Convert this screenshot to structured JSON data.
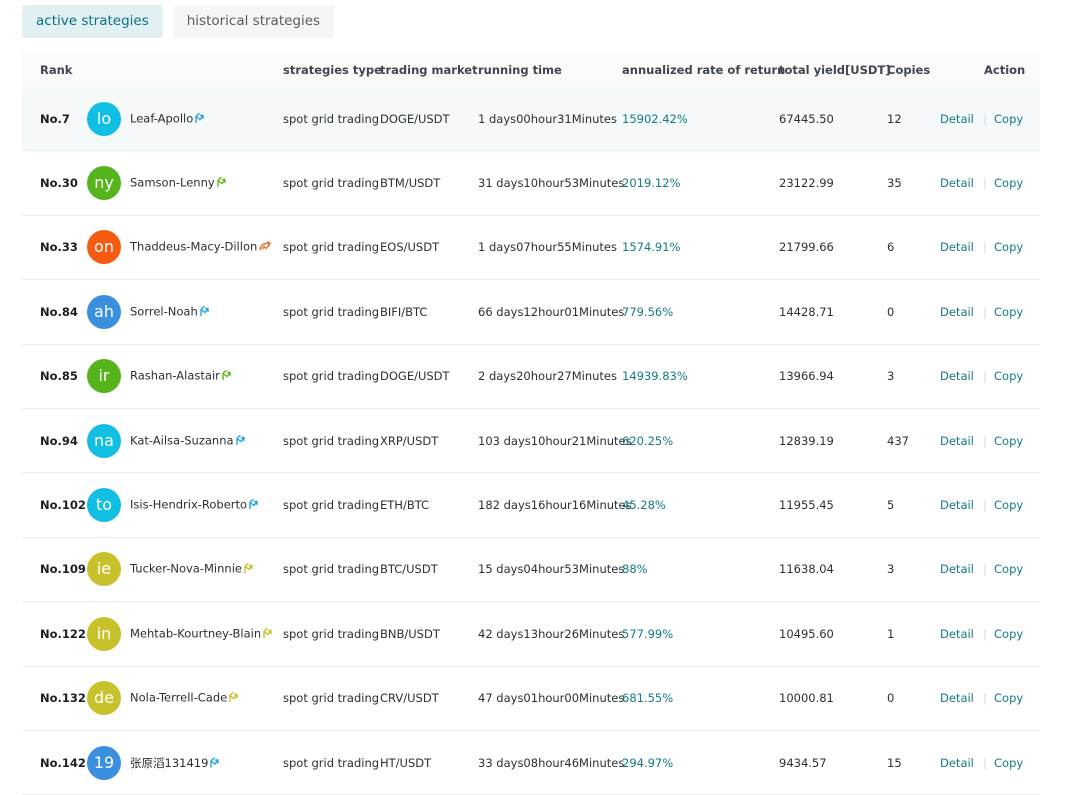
{
  "tabs": [
    {
      "label": "active strategies",
      "active": true
    },
    {
      "label": "historical strategies",
      "active": false
    }
  ],
  "table": {
    "headers": {
      "rank": "Rank",
      "type": "strategies type",
      "market": "trading market",
      "time": "running time",
      "rate": "annualized rate of return",
      "yield": "total yield[USDT]",
      "copies": "Copies",
      "action": "Action"
    },
    "detail_label": "Detail",
    "copy_label": "Copy",
    "separator": "|",
    "colors": {
      "accent": "#127a84",
      "badge_blue": "#22a6e0",
      "badge_green": "#5fb81e",
      "badge_olive": "#c4c025",
      "badge_orange": "#f26522"
    },
    "rows": [
      {
        "rank": "No.7",
        "initials": "lo",
        "avatar_color": "#11bfe3",
        "name": "Leaf-Apollo",
        "badge_color": "#22a6e0",
        "badge_icon": "growth-badge-icon",
        "type": "spot grid trading",
        "market": "DOGE/USDT",
        "time": "1 days00hour31Minutes",
        "rate": "15902.42%",
        "yield": "67445.50",
        "copies": "12"
      },
      {
        "rank": "No.30",
        "initials": "ny",
        "avatar_color": "#55b41c",
        "name": "Samson-Lenny",
        "badge_color": "#5fb81e",
        "badge_icon": "growth-badge-icon",
        "type": "spot grid trading",
        "market": "BTM/USDT",
        "time": "31 days10hour53Minutes",
        "rate": "2019.12%",
        "yield": "23122.99",
        "copies": "35"
      },
      {
        "rank": "No.33",
        "initials": "on",
        "avatar_color": "#f75b12",
        "name": "Thaddeus-Macy-Dillon",
        "badge_color": "#f26522",
        "badge_icon": "flame-badge-icon",
        "type": "spot grid trading",
        "market": "EOS/USDT",
        "time": "1 days07hour55Minutes",
        "rate": "1574.91%",
        "yield": "21799.66",
        "copies": "6"
      },
      {
        "rank": "No.84",
        "initials": "ah",
        "avatar_color": "#3b8fdf",
        "name": "Sorrel-Noah",
        "badge_color": "#22a6e0",
        "badge_icon": "growth-badge-icon",
        "type": "spot grid trading",
        "market": "BIFI/BTC",
        "time": "66 days12hour01Minutes",
        "rate": "779.56%",
        "yield": "14428.71",
        "copies": "0"
      },
      {
        "rank": "No.85",
        "initials": "ir",
        "avatar_color": "#55b41c",
        "name": "Rashan-Alastair",
        "badge_color": "#5fb81e",
        "badge_icon": "growth-badge-icon",
        "type": "spot grid trading",
        "market": "DOGE/USDT",
        "time": "2 days20hour27Minutes",
        "rate": "14939.83%",
        "yield": "13966.94",
        "copies": "3"
      },
      {
        "rank": "No.94",
        "initials": "na",
        "avatar_color": "#11bfe3",
        "name": "Kat-Ailsa-Suzanna",
        "badge_color": "#22a6e0",
        "badge_icon": "growth-badge-icon",
        "type": "spot grid trading",
        "market": "XRP/USDT",
        "time": "103 days10hour21Minutes",
        "rate": "620.25%",
        "yield": "12839.19",
        "copies": "437"
      },
      {
        "rank": "No.102",
        "initials": "to",
        "avatar_color": "#11bfe3",
        "name": "Isis-Hendrix-Roberto",
        "badge_color": "#22a6e0",
        "badge_icon": "growth-badge-icon",
        "type": "spot grid trading",
        "market": "ETH/BTC",
        "time": "182 days16hour16Minutes",
        "rate": "45.28%",
        "yield": "11955.45",
        "copies": "5"
      },
      {
        "rank": "No.109",
        "initials": "ie",
        "avatar_color": "#c7c12b",
        "name": "Tucker-Nova-Minnie",
        "badge_color": "#c4c025",
        "badge_icon": "growth-badge-icon",
        "type": "spot grid trading",
        "market": "BTC/USDT",
        "time": "15 days04hour53Minutes",
        "rate": "88%",
        "yield": "11638.04",
        "copies": "3"
      },
      {
        "rank": "No.122",
        "initials": "in",
        "avatar_color": "#c7c12b",
        "name": "Mehtab-Kourtney-Blain",
        "badge_color": "#c4c025",
        "badge_icon": "growth-badge-icon",
        "type": "spot grid trading",
        "market": "BNB/USDT",
        "time": "42 days13hour26Minutes",
        "rate": "577.99%",
        "yield": "10495.60",
        "copies": "1"
      },
      {
        "rank": "No.132",
        "initials": "de",
        "avatar_color": "#c7c12b",
        "name": "Nola-Terrell-Cade",
        "badge_color": "#c4c025",
        "badge_icon": "growth-badge-icon",
        "type": "spot grid trading",
        "market": "CRV/USDT",
        "time": "47 days01hour00Minutes",
        "rate": "681.55%",
        "yield": "10000.81",
        "copies": "0"
      },
      {
        "rank": "No.142",
        "initials": "19",
        "avatar_color": "#3b8fdf",
        "name": "张原滔131419",
        "badge_color": "#22a6e0",
        "badge_icon": "growth-badge-icon",
        "type": "spot grid trading",
        "market": "HT/USDT",
        "time": "33 days08hour46Minutes",
        "rate": "294.97%",
        "yield": "9434.57",
        "copies": "15"
      }
    ]
  }
}
